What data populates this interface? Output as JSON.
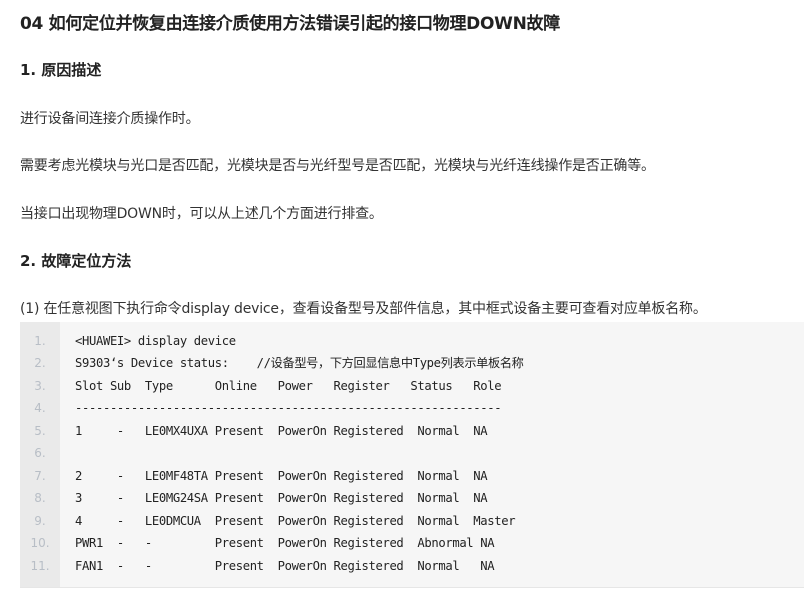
{
  "article": {
    "title": "04 如何定位并恢复由连接介质使用方法错误引起的接口物理DOWN故障",
    "section1": {
      "heading": "1. 原因描述",
      "paragraphs": [
        "进行设备间连接介质操作时。",
        "需要考虑光模块与光口是否匹配，光模块是否与光纤型号是否匹配，光模块与光纤连线操作是否正确等。",
        "当接口出现物理DOWN时，可以从上述几个方面进行排查。"
      ]
    },
    "section2": {
      "heading": "2. 故障定位方法",
      "step1": "(1) 在任意视图下执行命令display device，查看设备型号及部件信息，其中框式设备主要可查看对应单板名称。"
    },
    "code": {
      "lines": [
        {
          "num": "1.",
          "text": "<HUAWEI> display device"
        },
        {
          "num": "2.",
          "text": "S9303‘s Device status:    //设备型号，下方回显信息中Type列表示单板名称"
        },
        {
          "num": "3.",
          "text": "Slot Sub  Type      Online   Power   Register   Status   Role"
        },
        {
          "num": "4.",
          "text": "-------------------------------------------------------------"
        },
        {
          "num": "5.",
          "text": "1     -   LE0MX4UXA Present  PowerOn Registered  Normal  NA"
        },
        {
          "num": "6.",
          "text": ""
        },
        {
          "num": "7.",
          "text": "2     -   LE0MF48TA Present  PowerOn Registered  Normal  NA"
        },
        {
          "num": "8.",
          "text": "3     -   LE0MG24SA Present  PowerOn Registered  Normal  NA"
        },
        {
          "num": "9.",
          "text": "4     -   LE0DMCUA  Present  PowerOn Registered  Normal  Master"
        },
        {
          "num": "10.",
          "text": "PWR1  -   -         Present  PowerOn Registered  Abnormal NA"
        },
        {
          "num": "11.",
          "text": "FAN1  -   -         Present  PowerOn Registered  Normal   NA"
        }
      ]
    }
  }
}
